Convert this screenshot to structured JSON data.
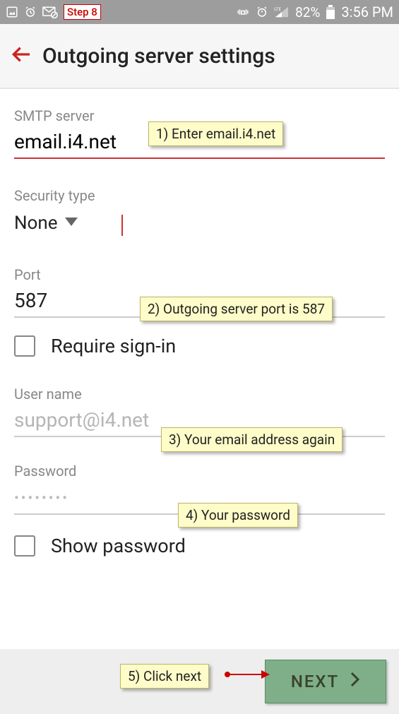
{
  "status_bar": {
    "step_badge": "Step 8",
    "battery_pct": "82%",
    "clock": "3:56 PM"
  },
  "header": {
    "title": "Outgoing server settings"
  },
  "fields": {
    "smtp": {
      "label": "SMTP server",
      "value": "email.i4.net"
    },
    "security": {
      "label": "Security type",
      "value": "None"
    },
    "port": {
      "label": "Port",
      "value": "587"
    },
    "require_signin": {
      "label": "Require sign-in",
      "checked": false
    },
    "username": {
      "label": "User name",
      "value": "support@i4.net"
    },
    "password": {
      "label": "Password",
      "value": "••••••••"
    },
    "show_password": {
      "label": "Show password",
      "checked": false
    }
  },
  "bottom": {
    "next_label": "NEXT"
  },
  "callouts": {
    "c1": "1) Enter email.i4.net",
    "c2": "2) Outgoing server port is 587",
    "c3": "3) Your email address again",
    "c4": "4) Your password",
    "c5": "5) Click next"
  }
}
